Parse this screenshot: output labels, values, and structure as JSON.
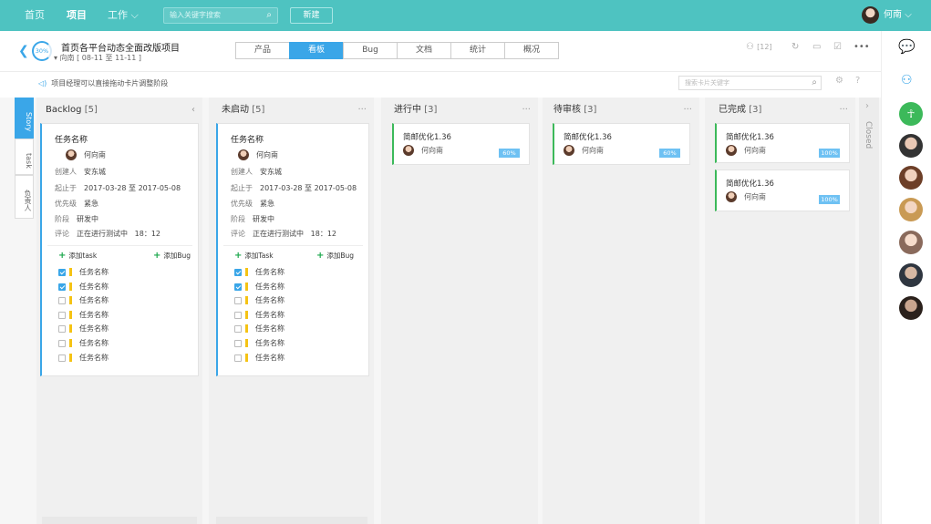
{
  "topnav": {
    "home": "首页",
    "project": "项目",
    "work": "工作",
    "search_placeholder": "输入关键字搜索",
    "new_btn": "新建",
    "user": "何南"
  },
  "project": {
    "progress": "30%",
    "title": "首页各平台动态全面改版项目",
    "sub": "向南 [ 08-11 至 11-11 ]"
  },
  "tabs": [
    "产品",
    "看板",
    "Bug",
    "文档",
    "统计",
    "概况"
  ],
  "active_tab": 1,
  "toolbar": {
    "members": "[12]"
  },
  "info": {
    "notice": "项目经理可以直接拖动卡片调整阶段",
    "card_search": "搜索卡片关键字"
  },
  "sidetabs": [
    "Story",
    "task",
    "负责人"
  ],
  "columns": [
    {
      "name": "Backlog",
      "count": "[5]"
    },
    {
      "name": "未启动",
      "count": "[5]"
    },
    {
      "name": "进行中",
      "count": "[3]"
    },
    {
      "name": "待审核",
      "count": "[3]"
    },
    {
      "name": "已完成",
      "count": "[3]"
    }
  ],
  "bigcard": {
    "title": "任务名称",
    "owner": "何向南",
    "creator_k": "创建人",
    "creator": "安东城",
    "range_k": "起止于",
    "range": "2017-03-28 至 2017-05-08",
    "priority_k": "优先级",
    "priority": "紧急",
    "stage_k": "阶段",
    "stage": "研发中",
    "comment_k": "评论",
    "comment": "正在进行测试中",
    "comment_time": "18：12",
    "add_task": "添加task",
    "add_task2": "添加Task",
    "add_bug": "添加Bug",
    "tasks": [
      {
        "label": "任务名称",
        "checked": true
      },
      {
        "label": "任务名称",
        "checked": true
      },
      {
        "label": "任务名称",
        "checked": false
      },
      {
        "label": "任务名称",
        "checked": false
      },
      {
        "label": "任务名称",
        "checked": false
      },
      {
        "label": "任务名称",
        "checked": false
      },
      {
        "label": "任务名称",
        "checked": false
      }
    ]
  },
  "mini": {
    "title": "简邮优化1.36",
    "user": "何向南"
  },
  "mini_pct": {
    "progress": "60%",
    "done": "100%"
  },
  "closed": "Closed"
}
